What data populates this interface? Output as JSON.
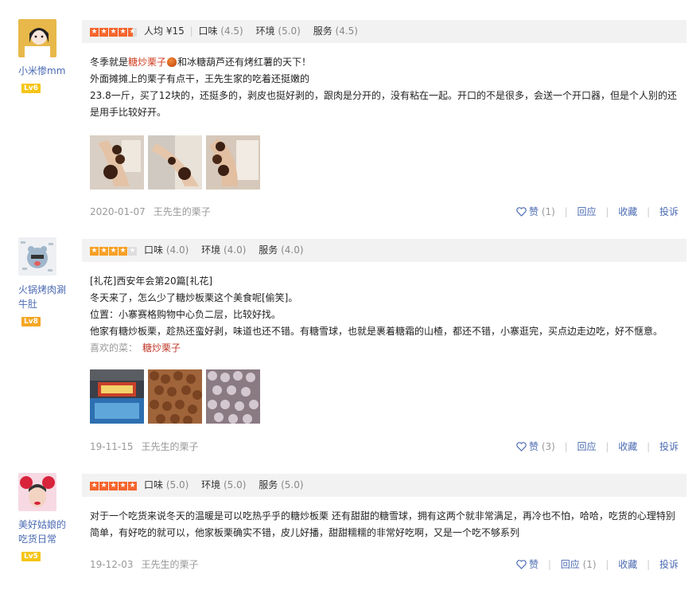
{
  "reviews": [
    {
      "user": "小米惨mm",
      "level": "Lv6",
      "rating_stars": 4.5,
      "avg_price": "人均 ¥15",
      "scores": [
        {
          "label": "口味",
          "value": "(4.5)"
        },
        {
          "label": "环境",
          "value": "(5.0)"
        },
        {
          "label": "服务",
          "value": "(4.5)"
        }
      ],
      "text": {
        "l1a": "冬季就是",
        "l1b": "糖炒栗子",
        "l1c": "和冰糖葫芦还有烤红薯的天下！",
        "l2": "外面摊摊上的栗子有点干，王先生家的吃着还挺嫩的",
        "l3": "23.8一斤，买了12块的，还挺多的，剥皮也挺好剥的，跟肉是分开的，没有粘在一起。开口的不是很多，会送一个开口器，但是个人别的还是用手比较好开。"
      },
      "date": "2020-01-07",
      "shop": "王先生的栗子",
      "actions": {
        "like": "赞",
        "like_count": "(1)",
        "reply": "回应",
        "fav": "收藏",
        "report": "投诉"
      }
    },
    {
      "user": "火锅烤肉涮牛肚",
      "level": "Lv8",
      "rating_stars": 4,
      "scores": [
        {
          "label": "口味",
          "value": "(4.0)"
        },
        {
          "label": "环境",
          "value": "(4.0)"
        },
        {
          "label": "服务",
          "value": "(4.0)"
        }
      ],
      "text": {
        "l1": "[礼花]西安年会第20篇[礼花]",
        "l2": "冬天来了，怎么少了糖炒板栗这个美食呢[偷笑]。",
        "l3": "位置：小寨赛格购物中心负二层，比较好找。",
        "l4": "他家有糖炒板栗，趁热还蛮好剥，味道也还不错。有糖雪球，也就是裹着糖霜的山楂，都还不错，小寨逛完，买点边走边吃，好不惬意。"
      },
      "liked_label": "喜欢的菜：",
      "liked_dish": "糖炒栗子",
      "date": "19-11-15",
      "shop": "王先生的栗子",
      "actions": {
        "like": "赞",
        "like_count": "(3)",
        "reply": "回应",
        "fav": "收藏",
        "report": "投诉"
      }
    },
    {
      "user": "美好姑娘的吃货日常",
      "level": "Lv5",
      "rating_stars": 5,
      "scores": [
        {
          "label": "口味",
          "value": "(5.0)"
        },
        {
          "label": "环境",
          "value": "(5.0)"
        },
        {
          "label": "服务",
          "value": "(5.0)"
        }
      ],
      "text": {
        "l1": "对于一个吃货来说冬天的温暖是可以吃热乎乎的糖炒板栗 还有甜甜的糖雪球，拥有这两个就非常满足，再冷也不怕，哈哈，吃货的心理特别简单，有好吃的就可以，他家板栗确实不错，皮儿好播，甜甜糯糯的非常好吃啊，又是一个吃不够系列"
      },
      "date": "19-12-03",
      "shop": "王先生的栗子",
      "actions": {
        "like": "赞",
        "reply": "回应",
        "reply_count": "(1)",
        "fav": "收藏",
        "report": "投诉"
      }
    }
  ],
  "colors": {
    "star": "#f5652c",
    "star_alt": "#f7a024",
    "link": "#4a6ab2",
    "highlight": "#d03b1d"
  },
  "icons": [
    "heart-icon",
    "star-icon",
    "chestnut-icon"
  ]
}
